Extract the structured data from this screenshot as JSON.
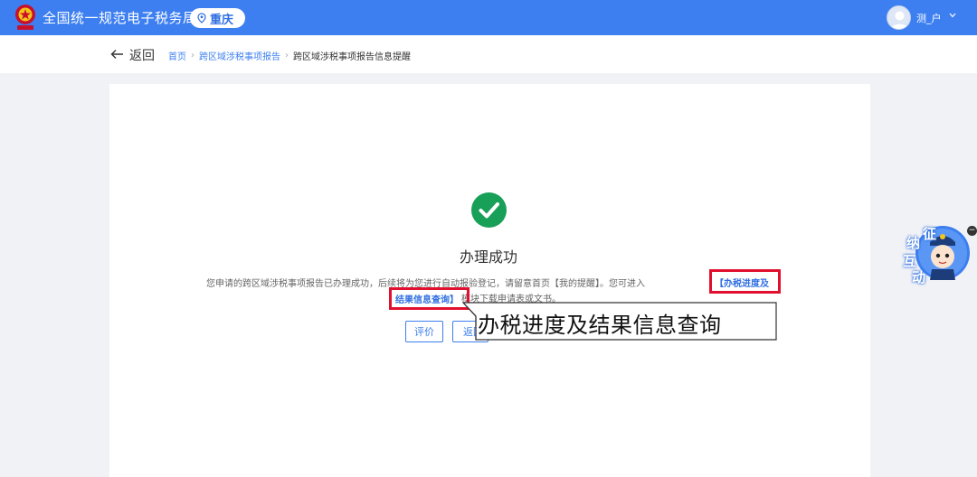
{
  "header": {
    "site_title": "全国统一规范电子税务局",
    "region": "重庆",
    "user_name": "测_户"
  },
  "breadcrumb": {
    "back_label": "返回",
    "items": [
      "首页",
      "跨区域涉税事项报告"
    ],
    "current": "跨区域涉税事项报告信息提醒"
  },
  "result": {
    "title": "办理成功",
    "message_part1": "您申请的跨区域涉税事项报告已办理成功，后续将为您进行自动报验登记，请留意首页【我的提醒】。您可进入",
    "link_part1": "【办税进度及",
    "link_part2": "结果信息查询】",
    "message_part2": "模块下载申请表或文书。",
    "buttons": {
      "rate": "评价",
      "return": "返回"
    }
  },
  "annotation": {
    "callout": "办税进度及结果信息查询"
  },
  "assistant": {
    "chars": [
      "征",
      "纳",
      "互",
      "动"
    ],
    "close": "−"
  },
  "colors": {
    "header_blue": "#3d7ff0",
    "success_green": "#18a058",
    "highlight_red": "#e0102e",
    "link_blue": "#2f6fe0"
  }
}
